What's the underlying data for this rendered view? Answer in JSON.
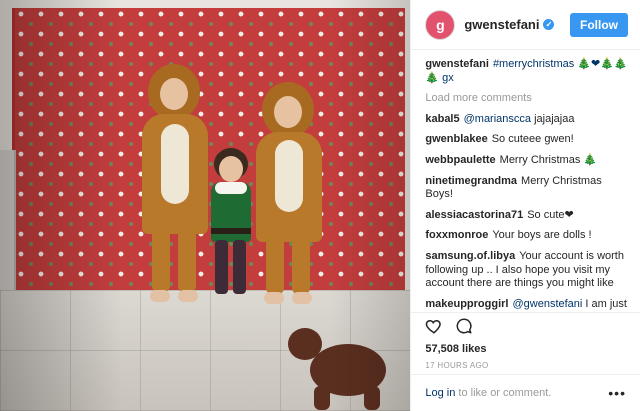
{
  "post": {
    "username": "gwenstefani",
    "avatar_initial": "g",
    "follow_label": "Follow",
    "load_more": "Load more comments",
    "caption": {
      "user": "gwenstefani",
      "text": "#merrychristmas 🎄❤🎄🎄🎄 gx"
    },
    "comments": [
      {
        "user": "kabal5",
        "mention": "@marianscca",
        "text": " jajajajaa"
      },
      {
        "user": "gwenblakee",
        "mention": "",
        "text": "So cuteee gwen!"
      },
      {
        "user": "webbpaulette",
        "mention": "",
        "text": "Merry Christmas 🎄"
      },
      {
        "user": "ninetimegrandma",
        "mention": "",
        "text": "Merry Christmas Boys!"
      },
      {
        "user": "alessiacastorina71",
        "mention": "",
        "text": "So cute❤"
      },
      {
        "user": "foxxmonroe",
        "mention": "",
        "text": "Your boys are dolls !"
      },
      {
        "user": "samsung.of.libya",
        "mention": "",
        "text": "Your account is worth following up .. I also hope you visit my account there are things you might like"
      },
      {
        "user": "makeupproggirl",
        "mention": "@gwenstefani",
        "text": " I am just so in love with this adorable pic, thank you so much fir sharing and showing how amazing your heart is and your family is just adorable, made me smile seeing your post!! ❤"
      }
    ],
    "likes": "57,508 likes",
    "time_ago": "17 HOURS AGO",
    "footer_login": "Log in",
    "footer_text": " to like or comment.",
    "more_dots": "•••"
  },
  "icons": [
    "heart-icon",
    "comment-icon",
    "verified-badge-icon",
    "more-options-icon"
  ],
  "colors": {
    "follow_button": "#3897f0",
    "link": "#003569",
    "muted": "#999999"
  }
}
